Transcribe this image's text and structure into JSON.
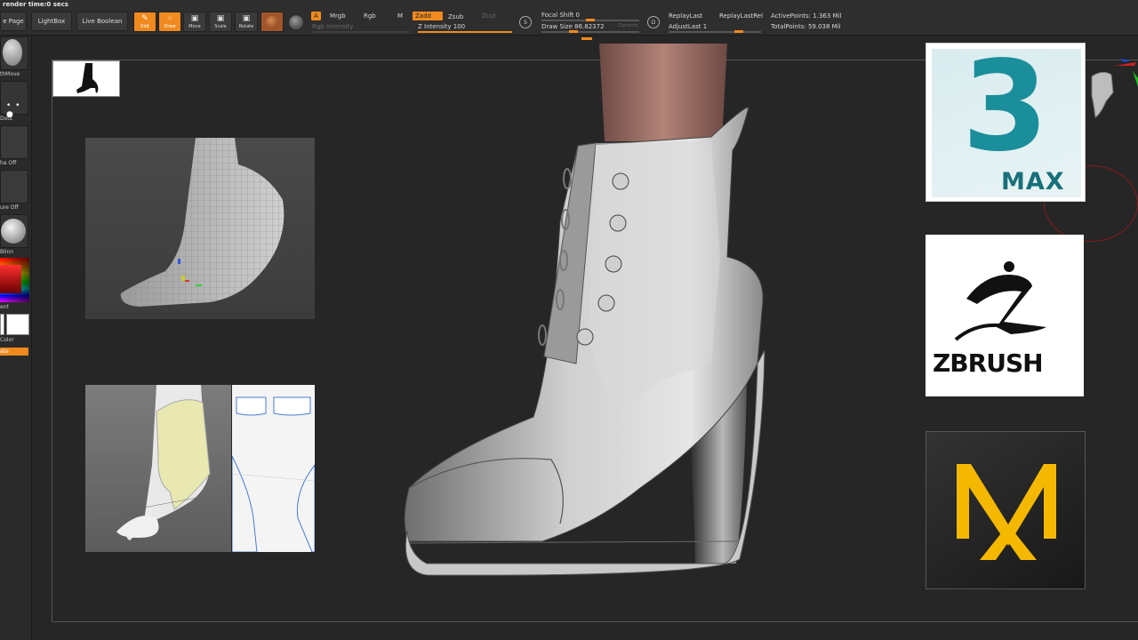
{
  "topbar": {
    "render_time": "render time:0 secs",
    "buttons": {
      "page": "e Page",
      "lightbox": "LightBox",
      "live_boolean": "Live Boolean"
    },
    "tools": {
      "edit": "Edit",
      "draw": "Draw",
      "move": "Move",
      "scale": "Scale",
      "rotate": "Rotate"
    },
    "channels": {
      "a": "A",
      "mrgb": "Mrgb",
      "rgb": "Rgb",
      "m": "M",
      "zadd": "Zadd",
      "zsub": "Zsub",
      "zcut": "Zcut",
      "rgb_intensity": "Rgb Intensity",
      "z_intensity_label": "Z Intensity",
      "z_intensity_value": "100"
    },
    "brush": {
      "focal_shift_label": "Focal Shift",
      "focal_shift_value": "0",
      "draw_size_label": "Draw Size",
      "draw_size_value": "86.82372",
      "dynamic": "Dynamic",
      "s_badge": "S",
      "d_badge": "D"
    },
    "replay": {
      "replay_last": "ReplayLast",
      "replay_last_rel": "ReplayLastRel",
      "adjust_last_label": "AdjustLast",
      "adjust_last_value": "1"
    },
    "stats": {
      "active_points": "ActivePoints: 1.363 Mil",
      "total_points": "TotalPoints: 59.038 Mil"
    },
    "z_intensity_fraction": 1.0,
    "focal_shift_fraction": 0.5,
    "draw_size_fraction": 0.33
  },
  "shelf": {
    "smoothmove": "thMove",
    "dots": "Dots",
    "alpha_off": "ha Off",
    "texture_off": "ure Off",
    "blinn": "Blinn",
    "gradient": "ent",
    "switch_color": "Color",
    "rotate_btn": "ate"
  },
  "logos": {
    "max": {
      "digit": "3",
      "text": "MAX",
      "accent": "#1a9aa6"
    },
    "zbrush": {
      "text": "ZBRUSH"
    },
    "marvelous": {
      "letters": "M",
      "accent": "#f5b800"
    }
  },
  "colors": {
    "accent": "#f08a1e",
    "background": "#262626"
  }
}
